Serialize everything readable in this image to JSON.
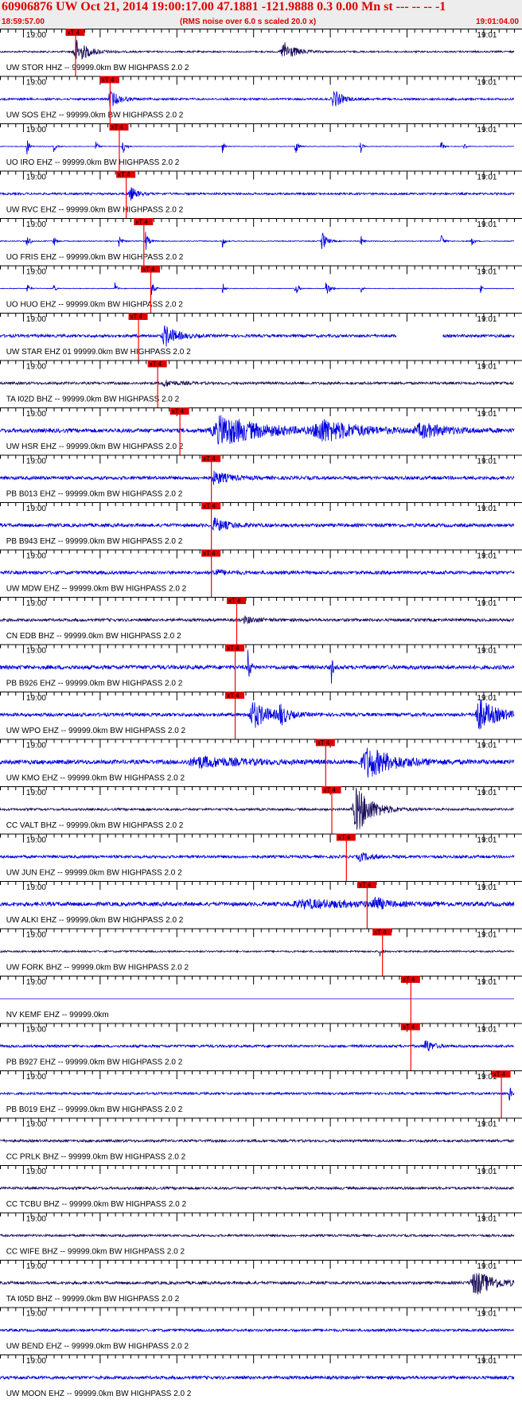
{
  "header": {
    "title": "60906876 UW Oct 21, 2014 19:00:17.00   47.1881 -121.9888  0.3 0.00 Mn st --- -- --   -1",
    "start_time": "18:59:57.00",
    "subtitle": "(RMS noise over 6.0 s scaled 20.0 x)",
    "end_time": "19:01:04.00"
  },
  "colors": {
    "header_text": "#e00000",
    "header_bg": "#ededed",
    "trace_blue": "#0000e0",
    "trace_dark": "#1a0e5a",
    "pick_red": "#ff0000",
    "pick_box": "#e00000"
  },
  "chart_data": {
    "type": "seismogram",
    "x_start": "18:59:57.00",
    "x_end": "19:01:04.00",
    "x_range_seconds": [
      0,
      67
    ],
    "tick_label_left": "19:00",
    "tick_label_right": "19:01",
    "pick_label": "xT 4",
    "traces": [
      {
        "label": "UW STOR HHZ -- 99999.0km BW  HIGHPASS  2.0  2",
        "color": "dark",
        "pick_s": 9.8,
        "bursts": [
          [
            9.9,
            2.6,
            0.9
          ],
          [
            37.0,
            2.6,
            0.7
          ]
        ],
        "noise": 0.06
      },
      {
        "label": "UW SOS EHZ -- 99999.0km BW  HIGHPASS  2.0  2",
        "color": "blue",
        "pick_s": 14.3,
        "bursts": [
          [
            14.4,
            2.0,
            0.6
          ],
          [
            43.5,
            1.8,
            0.7
          ]
        ],
        "noise": 0.07
      },
      {
        "label": "UO IRO EHZ -- 99999.0km BW  HIGHPASS  2.0  2",
        "color": "blue",
        "pick_s": 15.5,
        "bursts": [
          [
            3.5,
            0.5,
            0.6
          ],
          [
            7.0,
            0.5,
            0.4
          ],
          [
            12.5,
            0.4,
            0.5
          ],
          [
            16.0,
            0.6,
            0.6
          ],
          [
            29.0,
            0.4,
            0.5
          ],
          [
            38.5,
            0.6,
            0.6
          ],
          [
            47.0,
            0.4,
            0.5
          ],
          [
            57.5,
            0.4,
            0.5
          ],
          [
            60.5,
            0.3,
            0.5
          ]
        ],
        "noise": 0.02
      },
      {
        "label": "UW RVC EHZ -- 99999.0km BW  HIGHPASS  2.0  2",
        "color": "blue",
        "pick_s": 16.4,
        "bursts": [
          [
            17.0,
            1.5,
            0.5
          ]
        ],
        "noise": 0.07
      },
      {
        "label": "UO FRIS EHZ -- 99999.0km BW  HIGHPASS  2.0  2",
        "color": "blue",
        "pick_s": 18.7,
        "bursts": [
          [
            3.5,
            0.6,
            0.6
          ],
          [
            7.0,
            0.5,
            0.4
          ],
          [
            15.5,
            0.5,
            0.5
          ],
          [
            19.0,
            0.6,
            0.7
          ],
          [
            29.0,
            0.4,
            0.5
          ],
          [
            42.0,
            1.0,
            0.7
          ],
          [
            47.0,
            0.4,
            0.5
          ],
          [
            57.5,
            0.5,
            0.6
          ],
          [
            61.5,
            0.4,
            0.5
          ]
        ],
        "noise": 0.03
      },
      {
        "label": "UO HUO EHZ -- 99999.0km BW  HIGHPASS  2.0  2",
        "color": "blue",
        "pick_s": 19.6,
        "bursts": [
          [
            3.5,
            0.5,
            0.5
          ],
          [
            7.0,
            0.4,
            0.4
          ],
          [
            15.0,
            0.4,
            0.5
          ],
          [
            19.8,
            0.6,
            0.6
          ],
          [
            29.0,
            0.4,
            0.5
          ],
          [
            38.5,
            0.6,
            0.6
          ],
          [
            42.5,
            0.8,
            0.6
          ],
          [
            47.0,
            0.4,
            0.5
          ],
          [
            62.6,
            0.3,
            0.6
          ]
        ],
        "noise": 0.02
      },
      {
        "label": "UW STAR EHZ 01 99999.0km BW  HIGHPASS  2.0  2",
        "color": "blue",
        "pick_s": 18.0,
        "bursts": [
          [
            21.5,
            2.6,
            0.75
          ]
        ],
        "noise": 0.1,
        "gaps": [
          [
            51.7,
            57.7
          ]
        ]
      },
      {
        "label": "TA I02D BHZ -- 99999.0km BW  HIGHPASS  2.0  2",
        "color": "dark",
        "pick_s": 20.5,
        "bursts": [
          [
            21.5,
            3.0,
            0.2
          ]
        ],
        "noise": 0.09
      },
      {
        "label": "UW HSR EHZ -- 99999.0km BW  HIGHPASS  2.0  2",
        "color": "blue",
        "pick_s": 23.4,
        "bursts": [
          [
            29.0,
            9.0,
            1.05
          ],
          [
            42.0,
            8.0,
            0.75
          ],
          [
            55.0,
            6.0,
            0.45
          ]
        ],
        "noise": 0.14
      },
      {
        "label": "PB B013 EHZ -- 99999.0km BW  HIGHPASS  2.0  2",
        "color": "blue",
        "pick_s": 27.5,
        "bursts": [
          [
            28.0,
            3.0,
            0.45
          ]
        ],
        "noise": 0.12
      },
      {
        "label": "PB B943 EHZ -- 99999.0km BW  HIGHPASS  2.0  2",
        "color": "blue",
        "pick_s": 27.5,
        "bursts": [
          [
            28.0,
            3.0,
            0.45
          ]
        ],
        "noise": 0.12
      },
      {
        "label": "UW MDW EHZ -- 99999.0km BW  HIGHPASS  2.0  2",
        "color": "blue",
        "pick_s": 27.5,
        "bursts": [
          [
            28.0,
            2.5,
            0.2
          ]
        ],
        "noise": 0.12
      },
      {
        "label": "CN EDB BHZ -- 99999.0km BW  HIGHPASS  2.0  2",
        "color": "dark",
        "pick_s": 30.8,
        "bursts": [
          [
            32.0,
            3.0,
            0.2
          ]
        ],
        "noise": 0.1
      },
      {
        "label": "PB B926 EHZ -- 99999.0km BW  HIGHPASS  2.0  2",
        "color": "blue",
        "pick_s": 30.6,
        "bursts": [
          [
            32.3,
            0.4,
            1.6
          ],
          [
            43.2,
            0.3,
            1.2
          ]
        ],
        "noise": 0.14
      },
      {
        "label": "UW WPO EHZ -- 99999.0km BW  HIGHPASS  2.0  2",
        "color": "blue",
        "pick_s": 30.6,
        "bursts": [
          [
            33.0,
            3.5,
            0.95
          ],
          [
            36.5,
            1.5,
            0.7
          ],
          [
            62.5,
            4.0,
            1.1
          ]
        ],
        "noise": 0.12
      },
      {
        "label": "UW KMO EHZ -- 99999.0km BW  HIGHPASS  2.0  2",
        "color": "blue",
        "pick_s": 42.4,
        "bursts": [
          [
            26.0,
            10.0,
            0.35
          ],
          [
            48.0,
            6.0,
            1.05
          ]
        ],
        "noise": 0.15
      },
      {
        "label": "CC VALT BHZ -- 99999.0km BW  HIGHPASS  2.0  2",
        "color": "dark",
        "pick_s": 43.2,
        "bursts": [
          [
            46.5,
            3.5,
            1.7
          ]
        ],
        "noise": 0.08
      },
      {
        "label": "UW JUN EHZ -- 99999.0km BW  HIGHPASS  2.0  2",
        "color": "blue",
        "pick_s": 45.1,
        "bursts": [
          [
            47.0,
            3.0,
            0.25
          ]
        ],
        "noise": 0.1
      },
      {
        "label": "UW ALKI EHZ -- 99999.0km BW  HIGHPASS  2.0  2",
        "color": "blue",
        "pick_s": 47.8,
        "bursts": [
          [
            48.8,
            1.6,
            0.55
          ],
          [
            40.0,
            14.0,
            0.25
          ]
        ],
        "noise": 0.14
      },
      {
        "label": "UW FORK BHZ -- 99999.0km BW  HIGHPASS  2.0  2",
        "color": "dark",
        "pick_s": 49.8,
        "bursts": [
          [
            49.5,
            0.4,
            0.4
          ]
        ],
        "noise": 0.06
      },
      {
        "label": "NV KEMF EHZ -- 99999.0km",
        "color": "blue",
        "pick_s": 53.5,
        "bursts": [],
        "noise": 0.0
      },
      {
        "label": "PB B927 EHZ -- 99999.0km BW  HIGHPASS  2.0  2",
        "color": "blue",
        "pick_s": 53.5,
        "bursts": [
          [
            55.5,
            1.5,
            0.5
          ]
        ],
        "noise": 0.09
      },
      {
        "label": "PB B019 EHZ -- 99999.0km BW  HIGHPASS  2.0  2",
        "color": "blue",
        "pick_s": 65.3,
        "bursts": [
          [
            66.4,
            0.4,
            0.6
          ]
        ],
        "noise": 0.08
      },
      {
        "label": "CC PRLK BHZ -- 99999.0km BW  HIGHPASS  2.0  2",
        "color": "dark",
        "pick_s": null,
        "bursts": [],
        "noise": 0.09
      },
      {
        "label": "CC TCBU BHZ -- 99999.0km BW  HIGHPASS  2.0  2",
        "color": "dark",
        "pick_s": null,
        "bursts": [],
        "noise": 0.09
      },
      {
        "label": "CC WIFE BHZ -- 99999.0km BW  HIGHPASS  2.0  2",
        "color": "dark",
        "pick_s": null,
        "bursts": [],
        "noise": 0.08
      },
      {
        "label": "TA I05D BHZ -- 99999.0km BW  HIGHPASS  2.0  2",
        "color": "dark",
        "pick_s": null,
        "bursts": [
          [
            62.0,
            4.5,
            0.85
          ]
        ],
        "noise": 0.1
      },
      {
        "label": "UW BEND EHZ -- 99999.0km BW  HIGHPASS  2.0  2",
        "color": "blue",
        "pick_s": null,
        "bursts": [],
        "noise": 0.09
      },
      {
        "label": "UW MOON EHZ -- 99999.0km BW  HIGHPASS  2.0  2",
        "color": "blue",
        "pick_s": null,
        "bursts": [],
        "noise": 0.11
      }
    ]
  }
}
